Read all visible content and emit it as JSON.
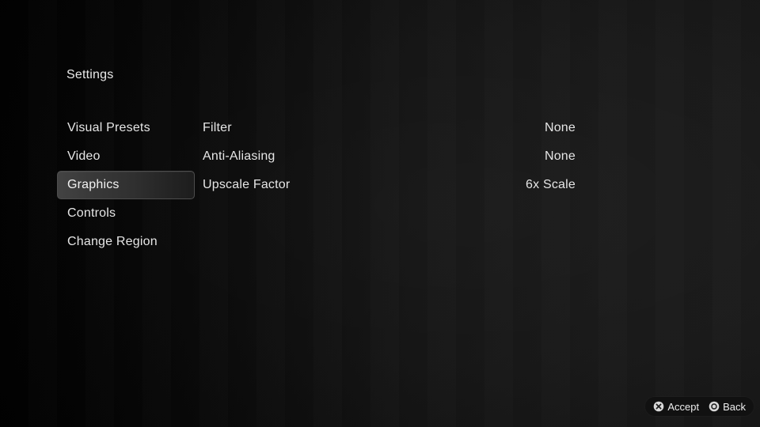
{
  "header": {
    "title": "Settings"
  },
  "sidebar": {
    "items": [
      {
        "label": "Visual Presets",
        "selected": false
      },
      {
        "label": "Video",
        "selected": false
      },
      {
        "label": "Graphics",
        "selected": true
      },
      {
        "label": "Controls",
        "selected": false
      },
      {
        "label": "Change Region",
        "selected": false
      }
    ]
  },
  "main": {
    "rows": [
      {
        "label": "Filter",
        "value": "None"
      },
      {
        "label": "Anti-Aliasing",
        "value": "None"
      },
      {
        "label": "Upscale Factor",
        "value": "6x Scale"
      }
    ]
  },
  "footer": {
    "hints": [
      {
        "icon": "cross-button-icon",
        "label": "Accept"
      },
      {
        "icon": "circle-button-icon",
        "label": "Back"
      }
    ]
  },
  "colors": {
    "text": "#e6e6e6",
    "selected_text": "#f2f2f2",
    "selection_border": "#4d4d4d",
    "background_left": "#000000",
    "background_right": "#181818",
    "hint_bar_background": "#111111",
    "button_glyph_fill": "#d9d9d9"
  }
}
